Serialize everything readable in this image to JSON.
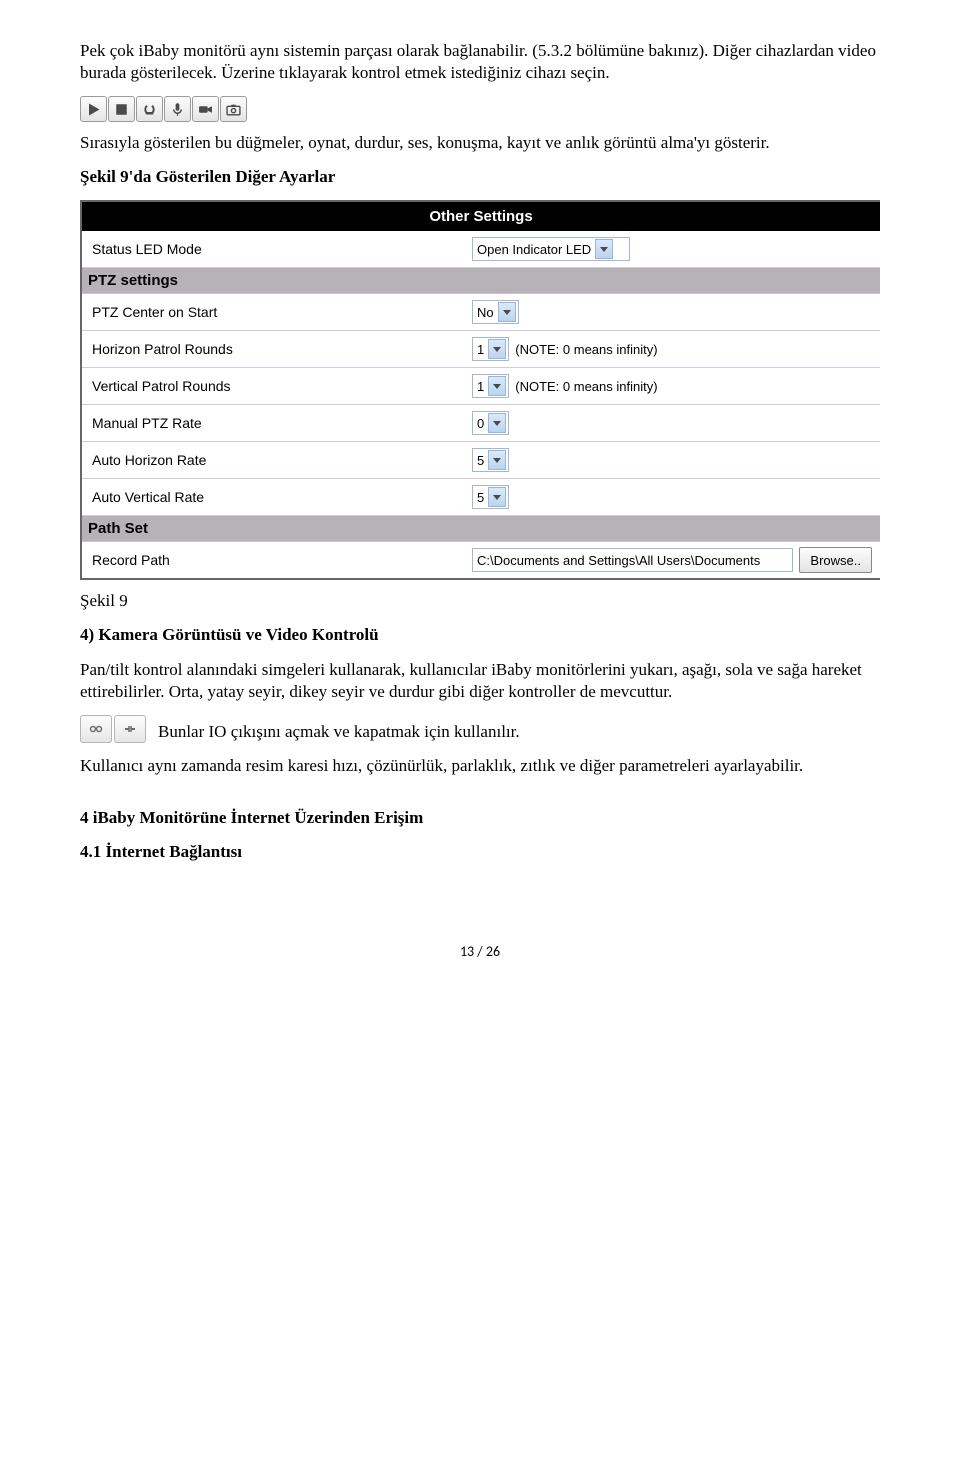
{
  "p1": "Pek çok iBaby monitörü aynı sistemin parçası olarak bağlanabilir. (5.3.2 bölümüne bakınız). Diğer cihazlardan video burada gösterilecek. Üzerine tıklayarak kontrol etmek istediğiniz cihazı seçin.",
  "p2": "Sırasıyla gösterilen bu düğmeler, oynat, durdur, ses, konuşma, kayıt ve anlık görüntü alma'yı gösterir.",
  "h1": "Şekil 9'da Gösterilen Diğer Ayarlar",
  "panel": {
    "title": "Other Settings",
    "rows": {
      "status_led": {
        "label": "Status LED Mode",
        "value": "Open Indicator LED"
      },
      "ptz_section": "PTZ settings",
      "ptz_center": {
        "label": "PTZ Center on Start",
        "value": "No"
      },
      "h_patrol": {
        "label": "Horizon Patrol Rounds",
        "value": "1",
        "note": "(NOTE: 0 means infinity)"
      },
      "v_patrol": {
        "label": "Vertical Patrol Rounds",
        "value": "1",
        "note": "(NOTE: 0 means infinity)"
      },
      "manual_rate": {
        "label": "Manual PTZ Rate",
        "value": "0"
      },
      "auto_h": {
        "label": "Auto Horizon Rate",
        "value": "5"
      },
      "auto_v": {
        "label": "Auto Vertical Rate",
        "value": "5"
      },
      "path_section": "Path Set",
      "record_path": {
        "label": "Record Path",
        "value": "C:\\Documents and Settings\\All Users\\Documents",
        "button": "Browse.."
      }
    }
  },
  "cap": "Şekil 9",
  "h2": "4) Kamera Görüntüsü ve Video Kontrolü",
  "p3": "Pan/tilt kontrol alanındaki simgeleri kullanarak, kullanıcılar iBaby monitörlerini yukarı, aşağı, sola ve sağa hareket ettirebilirler. Orta, yatay seyir, dikey seyir ve durdur gibi diğer kontroller de mevcuttur.",
  "p4": "Bunlar IO çıkışını açmak ve kapatmak için kullanılır.",
  "p5": "Kullanıcı aynı zamanda resim karesi hızı, çözünürlük, parlaklık, zıtlık ve diğer parametreleri ayarlayabilir.",
  "h3": "4 iBaby Monitörüne İnternet Üzerinden Erişim",
  "h4": "4.1 İnternet Bağlantısı",
  "page": "13 / 26"
}
